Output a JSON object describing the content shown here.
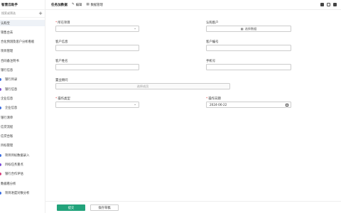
{
  "app": {
    "brand": "智营云助手"
  },
  "sidebar": {
    "search_placeholder": "搜索或筛选",
    "add_icon": "plus-icon",
    "items": [
      {
        "label": "认购宝",
        "child": false,
        "active": true
      },
      {
        "label": "销售台去",
        "child": false
      },
      {
        "label": "合化预测及客户分析看板",
        "child": false
      },
      {
        "label": "项目管理",
        "child": false
      },
      {
        "label": "合同备注明书",
        "child": false
      },
      {
        "label": "银行信息",
        "child": false
      },
      {
        "label": "银行目录",
        "child": true,
        "dot": "#3b6de0"
      },
      {
        "label": "银行信息",
        "child": true,
        "dot": "#7b4dd6"
      },
      {
        "label": "企业信息",
        "child": false
      },
      {
        "label": "企业信息",
        "child": true,
        "dot": "#3b6de0"
      },
      {
        "label": "银行清单",
        "child": false
      },
      {
        "label": "信贷流程",
        "child": false
      },
      {
        "label": "信贷台账",
        "child": false
      },
      {
        "label": "目标管理",
        "child": false
      },
      {
        "label": "项目目标数据录入",
        "child": true,
        "dot": "#3b6de0"
      },
      {
        "label": "目标任务重点",
        "child": true,
        "dot": "#7b4dd6"
      },
      {
        "label": "银行合作评估",
        "child": true,
        "dot": "#d6407b"
      },
      {
        "label": "数据看分析",
        "child": false
      },
      {
        "label": "项目进度对数分析",
        "child": true,
        "dot": "#3b6de0"
      }
    ]
  },
  "header": {
    "title": "任务加数据",
    "edit_label": "编辑",
    "manage_label": "数据管理",
    "edit_icon": "pencil-icon",
    "manage_icon": "database-icon"
  },
  "form": {
    "project_label": "所在项目",
    "project_value": "",
    "contract_label": "认购客户",
    "contract_button": "选择数据",
    "customer_info_label": "客户信息",
    "customer_no_label": "客户编号",
    "customer_name_label": "客户姓名",
    "phone_label": "手机号",
    "sales_consultant_label": "置业顾问",
    "sales_consultant_placeholder": "选择成员",
    "op_type_label": "操作类型",
    "op_date_label": "操作日期",
    "op_date_value": "2024-06-22"
  },
  "footer": {
    "submit_label": "提交",
    "save_draft_label": "保存草稿"
  },
  "colors": {
    "primary": "#22a37b",
    "required": "#e04040"
  }
}
